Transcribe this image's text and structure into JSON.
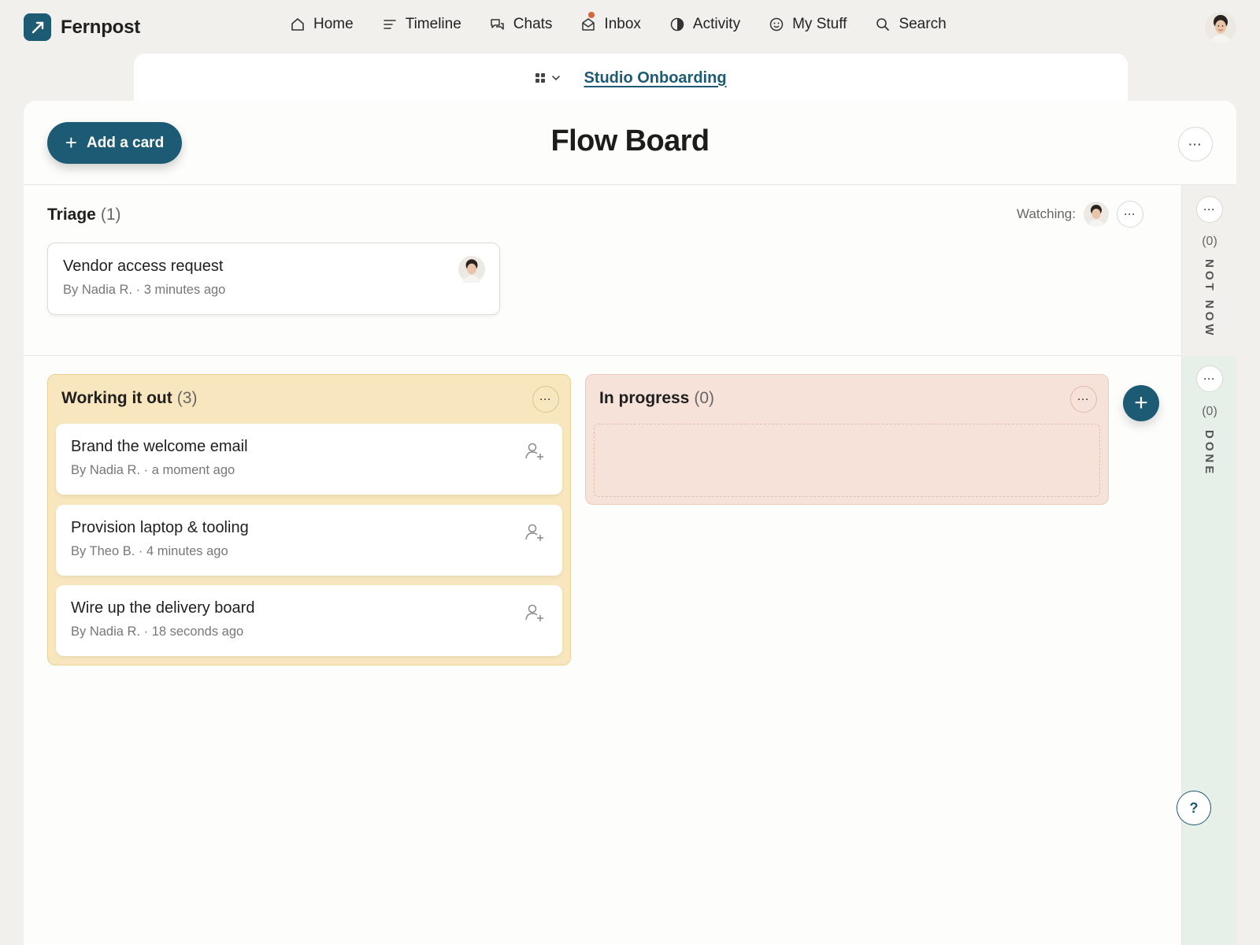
{
  "brand": {
    "name": "Fernpost"
  },
  "nav": {
    "home": "Home",
    "timeline": "Timeline",
    "chats": "Chats",
    "inbox": "Inbox",
    "activity": "Activity",
    "my_stuff": "My Stuff",
    "search": "Search"
  },
  "project": {
    "name": "Studio Onboarding"
  },
  "board": {
    "title": "Flow Board",
    "add_card_label": "Add a card",
    "more": "···"
  },
  "triage": {
    "title": "Triage",
    "count": "(1)",
    "watching_label": "Watching:",
    "cards": [
      {
        "title": "Vendor access request",
        "meta": "By Nadia R. · 3 minutes ago"
      }
    ]
  },
  "columns": [
    {
      "title": "Working it out",
      "count": "(3)",
      "cards": [
        {
          "title": "Brand the welcome email",
          "meta": "By Nadia R. · a moment ago"
        },
        {
          "title": "Provision laptop & tooling",
          "meta": "By Theo B. · 4 minutes ago"
        },
        {
          "title": "Wire up the delivery board",
          "meta": "By Nadia R. · 18 seconds ago"
        }
      ]
    },
    {
      "title": "In progress",
      "count": "(0)",
      "cards": []
    }
  ],
  "rails": {
    "not_now": {
      "count": "(0)",
      "label": "NOT NOW"
    },
    "done": {
      "count": "(0)",
      "label": "DONE"
    }
  },
  "help": "?",
  "colors": {
    "accent": "#1d5a73",
    "working_bg": "#f7e6be",
    "progress_bg": "#f7e2d9",
    "done_bg": "#e6efe8",
    "inbox_dot": "#d9653b"
  },
  "icons": [
    "app-logo-icon",
    "home-icon",
    "timeline-icon",
    "chats-icon",
    "inbox-icon",
    "activity-icon",
    "smiley-icon",
    "search-icon",
    "grid-icon",
    "chevron-down-icon",
    "plus-icon",
    "more-icon",
    "person-add-icon",
    "help-icon"
  ]
}
